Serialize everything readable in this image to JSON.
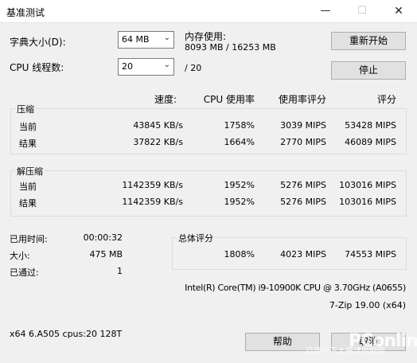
{
  "window": {
    "title": "基准测试",
    "minimize_glyph": "—",
    "maximize_glyph": "☐",
    "close_glyph": "✕"
  },
  "dictionary": {
    "label": "字典大小(D):",
    "value": "64 MB"
  },
  "threads": {
    "label": "CPU 线程数:",
    "value": "20",
    "suffix": "/ 20"
  },
  "memory": {
    "label": "内存使用:",
    "value": "8093 MB / 16253 MB"
  },
  "buttons": {
    "restart": "重新开始",
    "stop": "停止",
    "help": "帮助",
    "cancel": "取消"
  },
  "headers": {
    "speed": "速度:",
    "cpu_usage": "CPU 使用率",
    "rating_usage": "使用率评分",
    "rating": "评分"
  },
  "compress": {
    "title": "压缩",
    "rows": [
      {
        "label": "当前",
        "speed": "43845 KB/s",
        "usage": "1758%",
        "ru": "3039 MIPS",
        "rating": "53428 MIPS"
      },
      {
        "label": "结果",
        "speed": "37822 KB/s",
        "usage": "1664%",
        "ru": "2770 MIPS",
        "rating": "46089 MIPS"
      }
    ]
  },
  "decompress": {
    "title": "解压缩",
    "rows": [
      {
        "label": "当前",
        "speed": "1142359 KB/s",
        "usage": "1952%",
        "ru": "5276 MIPS",
        "rating": "103016 MIPS"
      },
      {
        "label": "结果",
        "speed": "1142359 KB/s",
        "usage": "1952%",
        "ru": "5276 MIPS",
        "rating": "103016 MIPS"
      }
    ]
  },
  "stats": {
    "elapsed_label": "已用时间:",
    "elapsed": "00:00:32",
    "size_label": "大小:",
    "size": "475 MB",
    "passes_label": "已通过:",
    "passes": "1"
  },
  "total": {
    "title": "总体评分",
    "usage": "1808%",
    "ru": "4023 MIPS",
    "rating": "74553 MIPS"
  },
  "cpu_info": "Intel(R) Core(TM) i9-10900K CPU @ 3.70GHz (A0655)",
  "version": "7-Zip 19.00 (x64)",
  "sysinfo": "x64 6.A505 cpus:20 128T",
  "watermark": {
    "logo": "PConline",
    "sub": "百度一下太平洋电脑网"
  }
}
